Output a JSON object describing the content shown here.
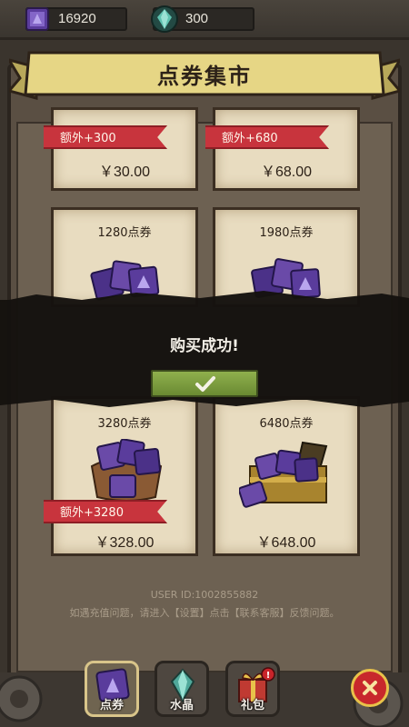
{
  "currencies": [
    {
      "name": "coupon",
      "value": "16920",
      "icon": "purple-coupon-icon"
    },
    {
      "name": "crystal",
      "value": "300",
      "icon": "teal-crystal-icon"
    }
  ],
  "title": "点券集市",
  "products": [
    {
      "name": "",
      "bonus": "额外+300",
      "price": "￥30.00"
    },
    {
      "name": "",
      "bonus": "额外+680",
      "price": "￥68.00"
    },
    {
      "name": "1280点券",
      "bonus": "",
      "price": ""
    },
    {
      "name": "1980点券",
      "bonus": "",
      "price": ""
    },
    {
      "name": "3280点券",
      "bonus": "额外+3280",
      "price": "￥328.00"
    },
    {
      "name": "6480点券",
      "bonus": "",
      "price": "￥648.00"
    }
  ],
  "dialog": {
    "message": "购买成功!",
    "confirm_icon": "checkmark-icon"
  },
  "footer": {
    "user_id": "USER ID:1002855882",
    "help": "如遇充值问题，请进入【设置】点击【联系客服】反馈问题。"
  },
  "nav": {
    "tabs": [
      {
        "label": "点券",
        "icon": "coupon-icon",
        "active": true
      },
      {
        "label": "水晶",
        "icon": "crystal-icon",
        "active": false
      },
      {
        "label": "礼包",
        "icon": "gift-icon",
        "active": false
      }
    ],
    "close_icon": "close-icon"
  },
  "colors": {
    "ribbon": "#c8343d",
    "confirm": "#7a9a3c",
    "coupon": "#6a4aa8",
    "crystal": "#4fa89a"
  }
}
